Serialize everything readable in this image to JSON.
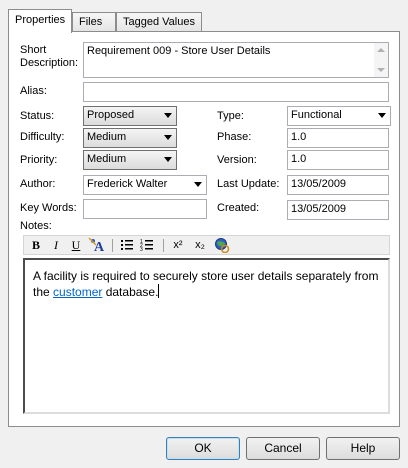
{
  "tabs": [
    {
      "label": "Properties"
    },
    {
      "label": "Files"
    },
    {
      "label": "Tagged Values"
    }
  ],
  "labels": {
    "short_description": "Short\nDescription:",
    "alias": "Alias:",
    "status": "Status:",
    "difficulty": "Difficulty:",
    "priority": "Priority:",
    "author": "Author:",
    "key_words": "Key Words:",
    "notes": "Notes:",
    "type": "Type:",
    "phase": "Phase:",
    "version": "Version:",
    "last_update": "Last Update:",
    "created": "Created:"
  },
  "values": {
    "short_description": "Requirement 009 - Store User Details",
    "alias": "",
    "status": "Proposed",
    "difficulty": "Medium",
    "priority": "Medium",
    "author": "Frederick Walter",
    "key_words": "",
    "type": "Functional",
    "phase": "1.0",
    "version": "1.0",
    "last_update": "13/05/2009",
    "created": "13/05/2009"
  },
  "notes": {
    "text_before": "A facility is required to securely store user details separately from the ",
    "link": "customer",
    "text_after": " database."
  },
  "toolbar": {
    "bold": "B",
    "italic": "I",
    "underline": "U",
    "superscript": "x²",
    "subscript": "x₂"
  },
  "buttons": {
    "ok": "OK",
    "cancel": "Cancel",
    "help": "Help"
  }
}
